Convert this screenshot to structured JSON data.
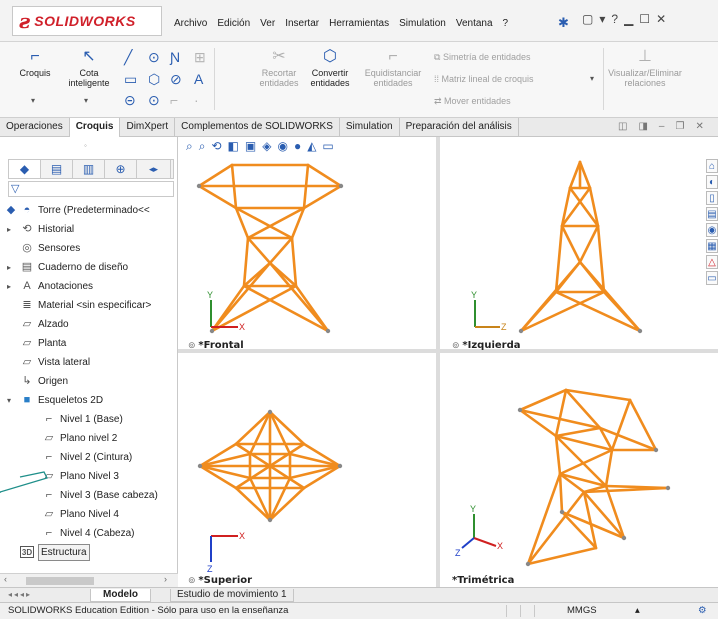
{
  "app": {
    "brand": "SOLIDWORKS",
    "menus": [
      "Archivo",
      "Edición",
      "Ver",
      "Insertar",
      "Herramientas",
      "Simulation",
      "Ventana",
      "?"
    ]
  },
  "commands": {
    "croquis": "Croquis",
    "cota": "Cota inteligente",
    "recortar": "Recortar entidades",
    "convertir": "Convertir entidades",
    "equidistanciar": "Equidistanciar entidades",
    "simetria": "Simetría de entidades",
    "matriz": "Matriz lineal de croquis",
    "mover": "Mover entidades",
    "relaciones": "Visualizar/Eliminar relaciones"
  },
  "tabs": [
    "Operaciones",
    "Croquis",
    "DimXpert",
    "Complementos de SOLIDWORKS",
    "Simulation",
    "Preparación del análisis"
  ],
  "active_tab": "Croquis",
  "tree": {
    "root": "Torre (Predeterminado<<",
    "items": [
      {
        "label": "Historial",
        "icon": "history-icon"
      },
      {
        "label": "Sensores",
        "icon": "sensor-icon"
      },
      {
        "label": "Cuaderno de diseño",
        "icon": "notebook-icon"
      },
      {
        "label": "Anotaciones",
        "icon": "annotation-icon"
      },
      {
        "label": "Material <sin especificar>",
        "icon": "material-icon"
      },
      {
        "label": "Alzado",
        "icon": "plane-icon"
      },
      {
        "label": "Planta",
        "icon": "plane-icon"
      },
      {
        "label": "Vista lateral",
        "icon": "plane-icon"
      },
      {
        "label": "Origen",
        "icon": "origin-icon"
      },
      {
        "label": "Esqueletos 2D",
        "icon": "folder-icon"
      },
      {
        "label": "Nivel 1 (Base)",
        "icon": "sketch-icon"
      },
      {
        "label": "Plano nivel 2",
        "icon": "plane-icon"
      },
      {
        "label": "Nivel 2 (Cintura)",
        "icon": "sketch-icon"
      },
      {
        "label": "Plano Nivel 3",
        "icon": "plane-icon"
      },
      {
        "label": "Nivel 3 (Base cabeza)",
        "icon": "sketch-icon"
      },
      {
        "label": "Plano Nivel 4",
        "icon": "plane-icon"
      },
      {
        "label": "Nivel 4 (Cabeza)",
        "icon": "sketch-icon"
      },
      {
        "label": "Estructura",
        "icon": "3d-sketch-icon"
      }
    ]
  },
  "viewports": {
    "frontal": "*Frontal",
    "izquierda": "*Izquierda",
    "superior": "*Superior",
    "trimetrica": "*Trimétrica"
  },
  "sheet_tabs": [
    "Modelo",
    "Estudio de movimiento 1"
  ],
  "status": {
    "message": "SOLIDWORKS Education Edition - Sólo para uso en la enseñanza",
    "units": "MMGS"
  },
  "colors": {
    "structure": "#f08c1e",
    "brand_red": "#d0202a",
    "accent_blue": "#2a5db0",
    "callout_teal": "#1f8f8a"
  }
}
